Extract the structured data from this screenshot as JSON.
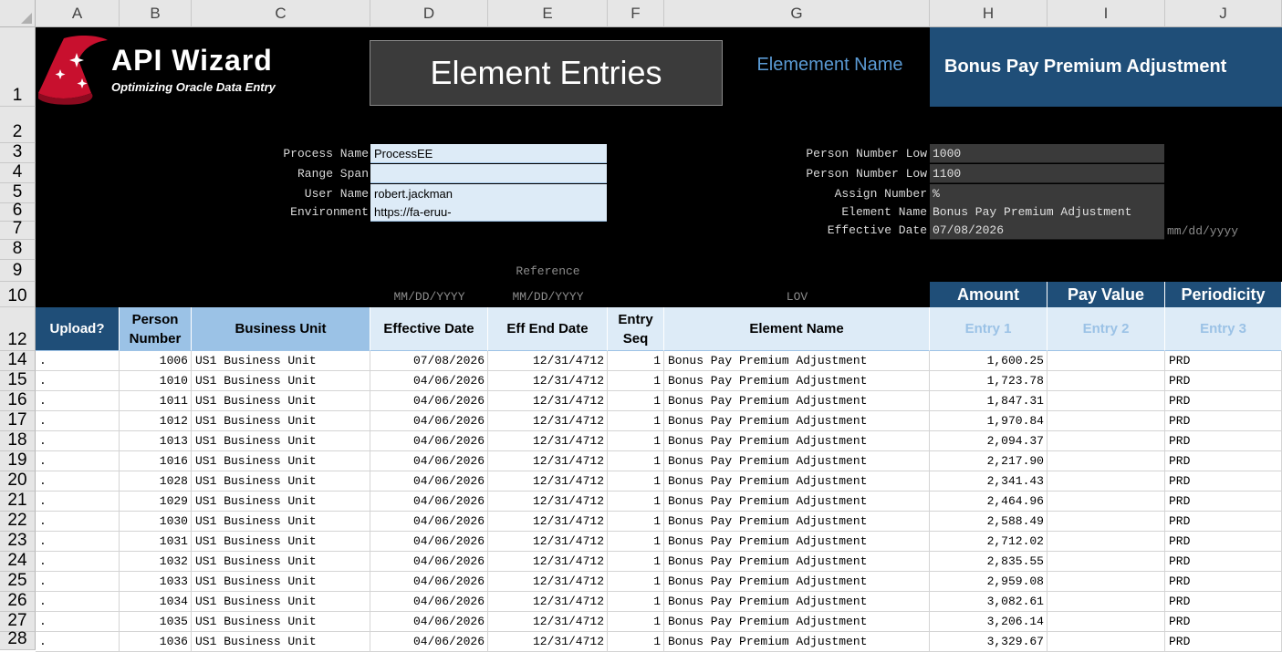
{
  "columns": [
    "A",
    "B",
    "C",
    "D",
    "E",
    "F",
    "G",
    "H",
    "I",
    "J"
  ],
  "row_numbers": [
    "1",
    "2",
    "3",
    "4",
    "5",
    "6",
    "7",
    "8",
    "9",
    "10",
    "12",
    "14",
    "15",
    "16",
    "17",
    "18",
    "19",
    "20",
    "21",
    "22",
    "23",
    "24",
    "25",
    "26",
    "27",
    "28"
  ],
  "logo": {
    "title": "API Wizard",
    "tagline": "Optimizing Oracle Data Entry"
  },
  "page_title": "Element Entries",
  "element_name_label": "Elemement Name",
  "element_name_value": "Bonus Pay Premium Adjustment",
  "left_params": [
    {
      "label": "Process Name",
      "value": "ProcessEE"
    },
    {
      "label": "Range Span",
      "value": ""
    },
    {
      "label": "User Name",
      "value": "robert.jackman"
    },
    {
      "label": "Environment",
      "value": "https://fa-eruu-"
    }
  ],
  "right_params": [
    {
      "label": "Person Number Low",
      "value": "1000"
    },
    {
      "label": "Person Number Low",
      "value": "1100"
    },
    {
      "label": "Assign Number",
      "value": "%"
    },
    {
      "label": "Element Name",
      "value": "Bonus Pay Premium Adjustment"
    },
    {
      "label": "Effective Date",
      "value": "07/08/2026"
    }
  ],
  "date_format_hint": "mm/dd/yyyy",
  "row9_reference": "Reference",
  "row10_hints": {
    "d": "MM/DD/YYYY",
    "e": "MM/DD/YYYY",
    "g": "LOV"
  },
  "row10_headers": {
    "h": "Amount",
    "i": "Pay Value",
    "j": "Periodicity"
  },
  "table_headers": {
    "a": "Upload?",
    "b": "Person\nNumber",
    "c": "Business Unit",
    "d": "Effective Date",
    "e": "Eff End Date",
    "f": "Entry\nSeq",
    "g": "Element Name",
    "h": "Entry 1",
    "i": "Entry 2",
    "j": "Entry 3"
  },
  "rows": [
    {
      "upload": ".",
      "person": "1006",
      "bu": "US1 Business Unit",
      "eff": "07/08/2026",
      "end": "12/31/4712",
      "seq": "1",
      "elem": "Bonus Pay Premium Adjustment",
      "amount": "1,600.25",
      "pay": "",
      "period": "PRD"
    },
    {
      "upload": ".",
      "person": "1010",
      "bu": "US1 Business Unit",
      "eff": "04/06/2026",
      "end": "12/31/4712",
      "seq": "1",
      "elem": "Bonus Pay Premium Adjustment",
      "amount": "1,723.78",
      "pay": "",
      "period": "PRD"
    },
    {
      "upload": ".",
      "person": "1011",
      "bu": "US1 Business Unit",
      "eff": "04/06/2026",
      "end": "12/31/4712",
      "seq": "1",
      "elem": "Bonus Pay Premium Adjustment",
      "amount": "1,847.31",
      "pay": "",
      "period": "PRD"
    },
    {
      "upload": ".",
      "person": "1012",
      "bu": "US1 Business Unit",
      "eff": "04/06/2026",
      "end": "12/31/4712",
      "seq": "1",
      "elem": "Bonus Pay Premium Adjustment",
      "amount": "1,970.84",
      "pay": "",
      "period": "PRD"
    },
    {
      "upload": ".",
      "person": "1013",
      "bu": "US1 Business Unit",
      "eff": "04/06/2026",
      "end": "12/31/4712",
      "seq": "1",
      "elem": "Bonus Pay Premium Adjustment",
      "amount": "2,094.37",
      "pay": "",
      "period": "PRD"
    },
    {
      "upload": ".",
      "person": "1016",
      "bu": "US1 Business Unit",
      "eff": "04/06/2026",
      "end": "12/31/4712",
      "seq": "1",
      "elem": "Bonus Pay Premium Adjustment",
      "amount": "2,217.90",
      "pay": "",
      "period": "PRD"
    },
    {
      "upload": ".",
      "person": "1028",
      "bu": "US1 Business Unit",
      "eff": "04/06/2026",
      "end": "12/31/4712",
      "seq": "1",
      "elem": "Bonus Pay Premium Adjustment",
      "amount": "2,341.43",
      "pay": "",
      "period": "PRD"
    },
    {
      "upload": ".",
      "person": "1029",
      "bu": "US1 Business Unit",
      "eff": "04/06/2026",
      "end": "12/31/4712",
      "seq": "1",
      "elem": "Bonus Pay Premium Adjustment",
      "amount": "2,464.96",
      "pay": "",
      "period": "PRD"
    },
    {
      "upload": ".",
      "person": "1030",
      "bu": "US1 Business Unit",
      "eff": "04/06/2026",
      "end": "12/31/4712",
      "seq": "1",
      "elem": "Bonus Pay Premium Adjustment",
      "amount": "2,588.49",
      "pay": "",
      "period": "PRD"
    },
    {
      "upload": ".",
      "person": "1031",
      "bu": "US1 Business Unit",
      "eff": "04/06/2026",
      "end": "12/31/4712",
      "seq": "1",
      "elem": "Bonus Pay Premium Adjustment",
      "amount": "2,712.02",
      "pay": "",
      "period": "PRD"
    },
    {
      "upload": ".",
      "person": "1032",
      "bu": "US1 Business Unit",
      "eff": "04/06/2026",
      "end": "12/31/4712",
      "seq": "1",
      "elem": "Bonus Pay Premium Adjustment",
      "amount": "2,835.55",
      "pay": "",
      "period": "PRD"
    },
    {
      "upload": ".",
      "person": "1033",
      "bu": "US1 Business Unit",
      "eff": "04/06/2026",
      "end": "12/31/4712",
      "seq": "1",
      "elem": "Bonus Pay Premium Adjustment",
      "amount": "2,959.08",
      "pay": "",
      "period": "PRD"
    },
    {
      "upload": ".",
      "person": "1034",
      "bu": "US1 Business Unit",
      "eff": "04/06/2026",
      "end": "12/31/4712",
      "seq": "1",
      "elem": "Bonus Pay Premium Adjustment",
      "amount": "3,082.61",
      "pay": "",
      "period": "PRD"
    },
    {
      "upload": ".",
      "person": "1035",
      "bu": "US1 Business Unit",
      "eff": "04/06/2026",
      "end": "12/31/4712",
      "seq": "1",
      "elem": "Bonus Pay Premium Adjustment",
      "amount": "3,206.14",
      "pay": "",
      "period": "PRD"
    },
    {
      "upload": ".",
      "person": "1036",
      "bu": "US1 Business Unit",
      "eff": "04/06/2026",
      "end": "12/31/4712",
      "seq": "1",
      "elem": "Bonus Pay Premium Adjustment",
      "amount": "3,329.67",
      "pay": "",
      "period": "PRD"
    }
  ]
}
